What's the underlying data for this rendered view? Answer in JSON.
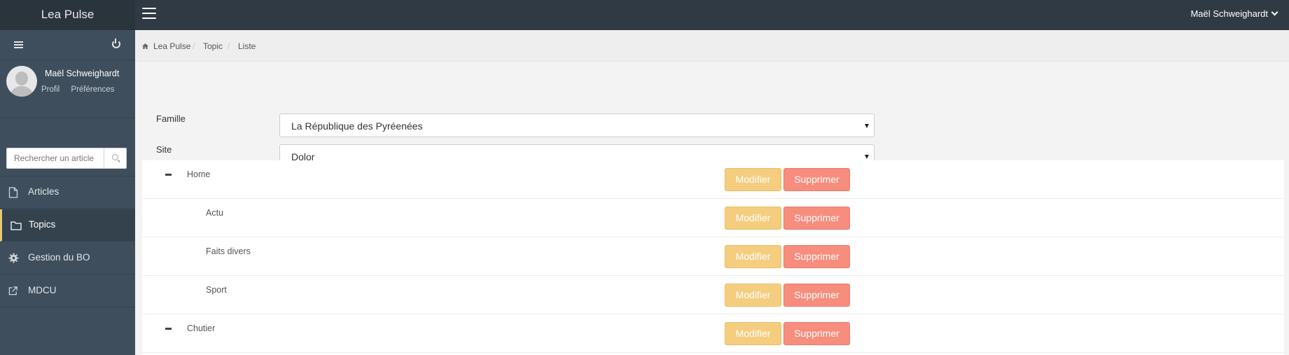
{
  "app": {
    "title": "Lea Pulse",
    "user_name": "Maël Schweighardt"
  },
  "sidebar": {
    "profile": {
      "name": "Maël Schweighardt",
      "links": [
        "Profil",
        "Préférences"
      ]
    },
    "search": {
      "placeholder": "Rechercher un article"
    },
    "items": [
      {
        "label": "Articles",
        "icon": "file-icon",
        "active": false
      },
      {
        "label": "Topics",
        "icon": "folder-icon",
        "active": true
      },
      {
        "label": "Gestion du BO",
        "icon": "gear-icon",
        "active": false
      },
      {
        "label": "MDCU",
        "icon": "external-link-icon",
        "active": false
      }
    ]
  },
  "breadcrumb": [
    "Lea Pulse",
    "Topic",
    "Liste"
  ],
  "filters": {
    "famille": {
      "label": "Famille",
      "value": "La République des Pyréenées"
    },
    "site": {
      "label": "Site",
      "value": "Dolor"
    }
  },
  "actions": {
    "edit": "Modifier",
    "delete": "Supprimer"
  },
  "topics": [
    {
      "name": "Home",
      "level": 0,
      "expanded": true
    },
    {
      "name": "Actu",
      "level": 1
    },
    {
      "name": "Faits divers",
      "level": 1
    },
    {
      "name": "Sport",
      "level": 1
    },
    {
      "name": "Chutier",
      "level": 0,
      "expanded": true
    }
  ],
  "colors": {
    "topbar": "#2f3a45",
    "sidebar": "#3e4e5c",
    "active_accent": "#e8c775",
    "edit_button": "#f5cd7f",
    "delete_button": "#f78d7d"
  }
}
